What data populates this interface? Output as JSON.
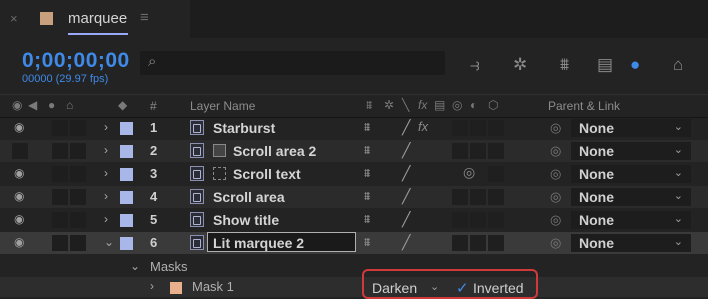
{
  "tab": {
    "title": "marquee",
    "close": "×",
    "menu": "≡",
    "swatch_color": "#c8a07e"
  },
  "toolbar": {
    "timecode": "0;00;00;00",
    "fps": "00000 (29.97 fps)",
    "search_icon": "search-icon",
    "icons": [
      "comp-mini-flowchart-icon",
      "draft-3d-icon",
      "shy-layers-icon",
      "frame-blending-icon",
      "motion-blur-icon",
      "graph-editor-icon"
    ]
  },
  "columns": {
    "number": "#",
    "layer_name": "Layer Name",
    "parent_link": "Parent & Link"
  },
  "layers": [
    {
      "number": "1",
      "name": "Starburst",
      "parent": "None",
      "selected": false
    },
    {
      "number": "2",
      "name": "Scroll area 2",
      "parent": "None",
      "selected": false
    },
    {
      "number": "3",
      "name": "Scroll text",
      "parent": "None",
      "selected": false
    },
    {
      "number": "4",
      "name": "Scroll area",
      "parent": "None",
      "selected": false
    },
    {
      "number": "5",
      "name": "Show title",
      "parent": "None",
      "selected": false
    },
    {
      "number": "6",
      "name": "Lit marquee 2",
      "parent": "None",
      "selected": true
    }
  ],
  "masks": {
    "label": "Masks",
    "items": [
      {
        "name": "Mask 1",
        "mode": "Darken",
        "inverted_label": "Inverted",
        "inverted": true
      }
    ]
  },
  "colors": {
    "accent": "#3f8ae8",
    "highlight": "#d03a3a",
    "label_color": "#a8b7e8"
  }
}
